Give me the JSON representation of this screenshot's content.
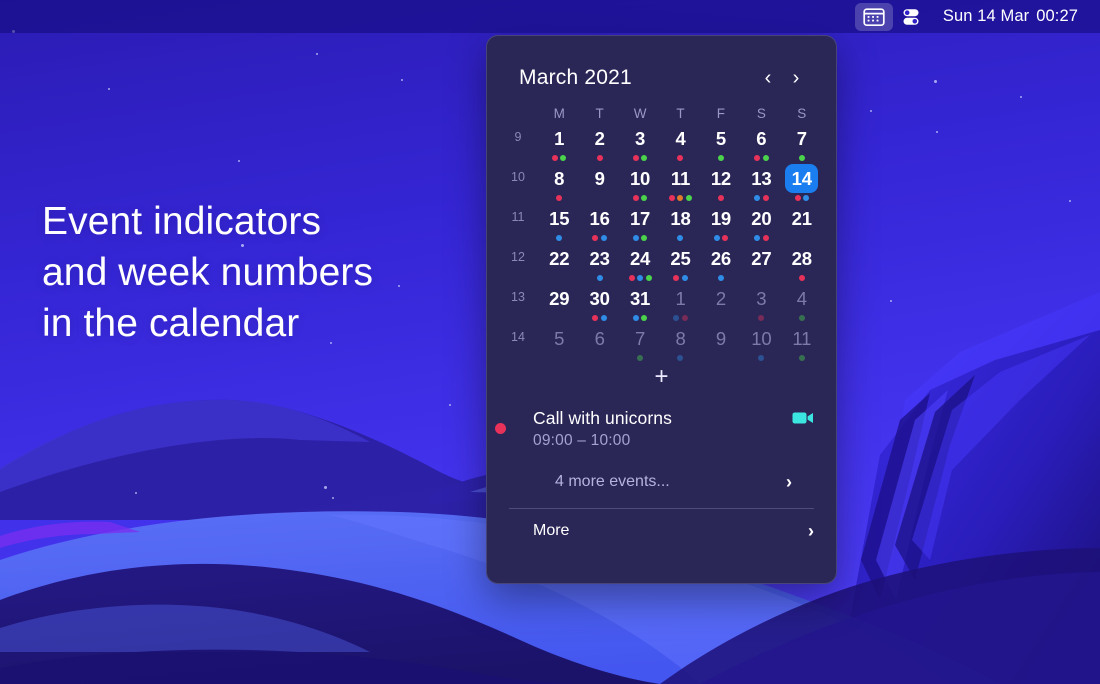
{
  "menubar": {
    "calendar_icon": "calendar-icon",
    "control_center_icon": "control-center-icon",
    "clock_date": "Sun 14 Mar",
    "clock_time": "00:27"
  },
  "headline": {
    "line1": "Event indicators",
    "line2": "and week numbers",
    "line3": "in the calendar"
  },
  "colors": {
    "red": "#e8325a",
    "green": "#4bd34b",
    "blue": "#2f8de8",
    "orange": "#e07b2a",
    "accent": "#1a7ef0",
    "cyan": "#3ce6e0",
    "panel": "#2a2757"
  },
  "calendar": {
    "title": "March 2021",
    "prev_label": "‹",
    "next_label": "›",
    "add_label": "+",
    "weekday_headers": [
      "M",
      "T",
      "W",
      "T",
      "F",
      "S",
      "S"
    ],
    "week_numbers": [
      "9",
      "10",
      "11",
      "12",
      "13",
      "14"
    ],
    "weeks": [
      {
        "week": "9",
        "days": [
          {
            "n": "1",
            "other": false,
            "today": false,
            "dots": [
              "red",
              "green"
            ]
          },
          {
            "n": "2",
            "other": false,
            "today": false,
            "dots": [
              "red"
            ]
          },
          {
            "n": "3",
            "other": false,
            "today": false,
            "dots": [
              "red",
              "green"
            ]
          },
          {
            "n": "4",
            "other": false,
            "today": false,
            "dots": [
              "red"
            ]
          },
          {
            "n": "5",
            "other": false,
            "today": false,
            "dots": [
              "green"
            ]
          },
          {
            "n": "6",
            "other": false,
            "today": false,
            "dots": [
              "red",
              "green"
            ]
          },
          {
            "n": "7",
            "other": false,
            "today": false,
            "dots": [
              "green"
            ]
          }
        ]
      },
      {
        "week": "10",
        "days": [
          {
            "n": "8",
            "other": false,
            "today": false,
            "dots": [
              "red"
            ]
          },
          {
            "n": "9",
            "other": false,
            "today": false,
            "dots": []
          },
          {
            "n": "10",
            "other": false,
            "today": false,
            "dots": [
              "red",
              "green"
            ]
          },
          {
            "n": "11",
            "other": false,
            "today": false,
            "dots": [
              "red",
              "orange",
              "green"
            ]
          },
          {
            "n": "12",
            "other": false,
            "today": false,
            "dots": [
              "red"
            ]
          },
          {
            "n": "13",
            "other": false,
            "today": false,
            "dots": [
              "blue",
              "red"
            ]
          },
          {
            "n": "14",
            "other": false,
            "today": true,
            "dots": [
              "red",
              "blue"
            ]
          }
        ]
      },
      {
        "week": "11",
        "days": [
          {
            "n": "15",
            "other": false,
            "today": false,
            "dots": [
              "blue"
            ]
          },
          {
            "n": "16",
            "other": false,
            "today": false,
            "dots": [
              "red",
              "blue"
            ]
          },
          {
            "n": "17",
            "other": false,
            "today": false,
            "dots": [
              "blue",
              "green"
            ]
          },
          {
            "n": "18",
            "other": false,
            "today": false,
            "dots": [
              "blue"
            ]
          },
          {
            "n": "19",
            "other": false,
            "today": false,
            "dots": [
              "blue",
              "red"
            ]
          },
          {
            "n": "20",
            "other": false,
            "today": false,
            "dots": [
              "blue",
              "red"
            ]
          },
          {
            "n": "21",
            "other": false,
            "today": false,
            "dots": []
          }
        ]
      },
      {
        "week": "12",
        "days": [
          {
            "n": "22",
            "other": false,
            "today": false,
            "dots": []
          },
          {
            "n": "23",
            "other": false,
            "today": false,
            "dots": [
              "blue"
            ]
          },
          {
            "n": "24",
            "other": false,
            "today": false,
            "dots": [
              "red",
              "blue",
              "green"
            ]
          },
          {
            "n": "25",
            "other": false,
            "today": false,
            "dots": [
              "red",
              "blue"
            ]
          },
          {
            "n": "26",
            "other": false,
            "today": false,
            "dots": [
              "blue"
            ]
          },
          {
            "n": "27",
            "other": false,
            "today": false,
            "dots": []
          },
          {
            "n": "28",
            "other": false,
            "today": false,
            "dots": [
              "red"
            ]
          }
        ]
      },
      {
        "week": "13",
        "days": [
          {
            "n": "29",
            "other": false,
            "today": false,
            "dots": []
          },
          {
            "n": "30",
            "other": false,
            "today": false,
            "dots": [
              "red",
              "blue"
            ]
          },
          {
            "n": "31",
            "other": false,
            "today": false,
            "dots": [
              "blue",
              "green"
            ]
          },
          {
            "n": "1",
            "other": true,
            "today": false,
            "dots": [
              "blue",
              "red"
            ]
          },
          {
            "n": "2",
            "other": true,
            "today": false,
            "dots": []
          },
          {
            "n": "3",
            "other": true,
            "today": false,
            "dots": [
              "red"
            ]
          },
          {
            "n": "4",
            "other": true,
            "today": false,
            "dots": [
              "green"
            ]
          }
        ]
      },
      {
        "week": "14",
        "days": [
          {
            "n": "5",
            "other": true,
            "today": false,
            "dots": []
          },
          {
            "n": "6",
            "other": true,
            "today": false,
            "dots": []
          },
          {
            "n": "7",
            "other": true,
            "today": false,
            "dots": [
              "green"
            ]
          },
          {
            "n": "8",
            "other": true,
            "today": false,
            "dots": [
              "blue"
            ]
          },
          {
            "n": "9",
            "other": true,
            "today": false,
            "dots": []
          },
          {
            "n": "10",
            "other": true,
            "today": false,
            "dots": [
              "blue"
            ]
          },
          {
            "n": "11",
            "other": true,
            "today": false,
            "dots": [
              "green"
            ]
          }
        ]
      }
    ]
  },
  "event": {
    "title": "Call with unicorns",
    "time": "09:00 – 10:00",
    "dot_color": "#e8325a",
    "video_icon": "video-camera-icon"
  },
  "footer": {
    "more_events_label": "4 more events...",
    "more_label": "More",
    "chevron": "›"
  }
}
